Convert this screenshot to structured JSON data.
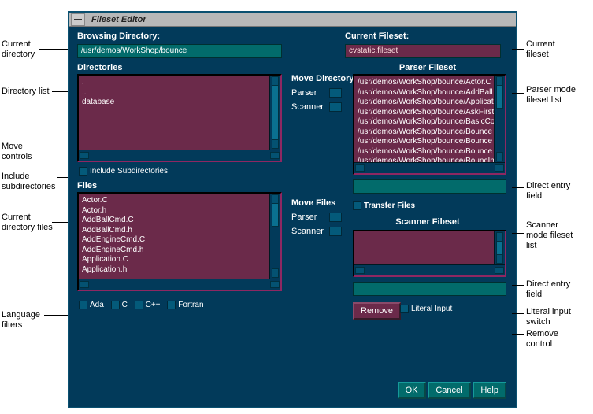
{
  "window": {
    "title": "Fileset Editor"
  },
  "browsing": {
    "label": "Browsing Directory:",
    "value": "/usr/demos/WorkShop/bounce"
  },
  "current_fileset": {
    "label": "Current Fileset:",
    "value": "cvstatic.fileset"
  },
  "directories": {
    "label": "Directories",
    "items": [
      ".",
      "..",
      "database"
    ]
  },
  "include_sub": {
    "label": "Include Subdirectories"
  },
  "files": {
    "label": "Files",
    "items": [
      "Actor.C",
      "Actor.h",
      "AddBallCmd.C",
      "AddBallCmd.h",
      "AddEngineCmd.C",
      "AddEngineCmd.h",
      "Application.C",
      "Application.h"
    ]
  },
  "move_dir": {
    "label": "Move Directory",
    "parser": "Parser",
    "scanner": "Scanner"
  },
  "move_files": {
    "label": "Move Files",
    "parser": "Parser",
    "scanner": "Scanner"
  },
  "parser_fileset": {
    "label": "Parser Fileset",
    "items": [
      "/usr/demos/WorkShop/bounce/Actor.C",
      "/usr/demos/WorkShop/bounce/AddBall",
      "/usr/demos/WorkShop/bounce/Applicat",
      "/usr/demos/WorkShop/bounce/AskFirst",
      "/usr/demos/WorkShop/bounce/BasicCo",
      "/usr/demos/WorkShop/bounce/Bounce",
      "/usr/demos/WorkShop/bounce/Bounce",
      "/usr/demos/WorkShop/bounce/Bounce",
      "/usr/demos/WorkShop/bounce/BouncIn"
    ]
  },
  "transfer_files": {
    "label": "Transfer Files"
  },
  "scanner_fileset": {
    "label": "Scanner Fileset",
    "items": []
  },
  "buttons": {
    "remove": "Remove",
    "literal": "Literal Input",
    "ok": "OK",
    "cancel": "Cancel",
    "help": "Help"
  },
  "filters": {
    "ada": "Ada",
    "c": "C",
    "cpp": "C++",
    "fortran": "Fortran"
  },
  "callouts": {
    "cur_dir": "Current\ndirectory",
    "dir_list": "Directory list",
    "move_ctrl": "Move\ncontrols",
    "inc_sub": "Include\nsubdirectories",
    "cur_files": "Current\ndirectory files",
    "lang_filters": "Language\nfilters",
    "cur_fileset": "Current\nfileset",
    "parser_list": "Parser mode\nfileset list",
    "direct1": "Direct entry\nfield",
    "scanner_list": "Scanner\nmode fileset\nlist",
    "direct2": "Direct entry\nfield",
    "literal": "Literal input\nswitch",
    "remove": "Remove\ncontrol"
  }
}
